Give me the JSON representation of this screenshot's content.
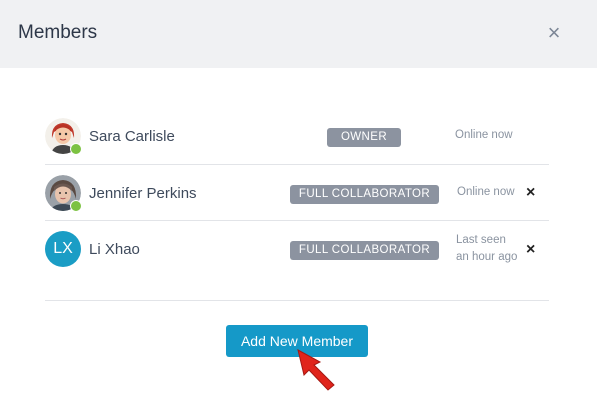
{
  "dialog": {
    "title": "Members",
    "close_label": "×"
  },
  "members": [
    {
      "name": "Sara Carlisle",
      "role": "OWNER",
      "status": "Online now",
      "online": true,
      "avatar": "photo"
    },
    {
      "name": "Jennifer Perkins",
      "role": "FULL COLLABORATOR",
      "status": "Online now",
      "online": true,
      "avatar": "photo",
      "remove_label": "×"
    },
    {
      "name": "Li Xhao",
      "role": "FULL COLLABORATOR",
      "status_line1": "Last seen",
      "status_line2": "an hour ago",
      "online": false,
      "initials": "LX",
      "remove_label": "×"
    }
  ],
  "add_button": {
    "label": "Add New Member"
  },
  "colors": {
    "accent": "#1599c8",
    "badge": "#8c93a0",
    "online": "#7cc242",
    "arrow": "#e0241b"
  }
}
